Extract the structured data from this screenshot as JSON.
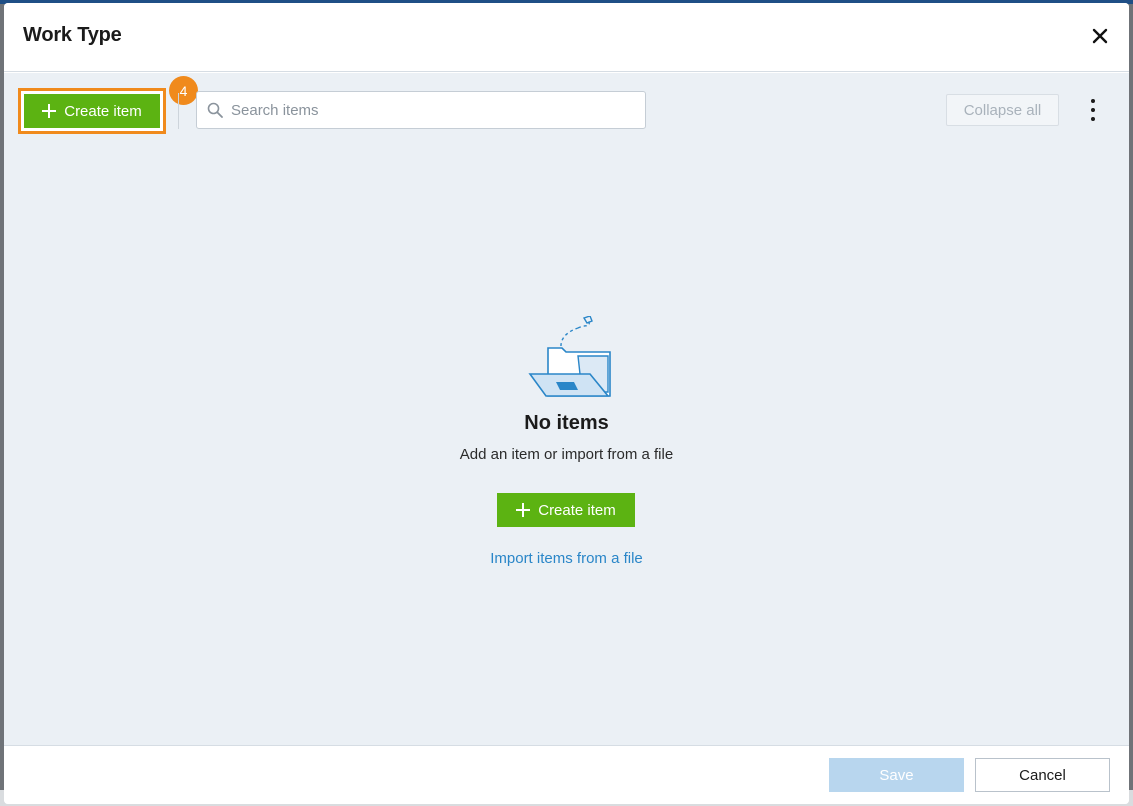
{
  "dialog": {
    "title": "Work Type"
  },
  "toolbar": {
    "create_label": "Create item",
    "step_badge": "4",
    "search_placeholder": "Search items",
    "collapse_label": "Collapse all"
  },
  "empty_state": {
    "title": "No items",
    "subtitle": "Add an item or import from a file",
    "create_label": "Create item",
    "import_label": "Import items from a file"
  },
  "footer": {
    "save_label": "Save",
    "cancel_label": "Cancel"
  },
  "colors": {
    "accent_green": "#5cb312",
    "highlight_orange": "#f08a1c",
    "link_blue": "#2a86c8",
    "body_bg": "#ebf0f5"
  },
  "icons": [
    "close-icon",
    "plus-icon",
    "search-icon",
    "more-vertical-icon",
    "empty-folder-illustration"
  ]
}
